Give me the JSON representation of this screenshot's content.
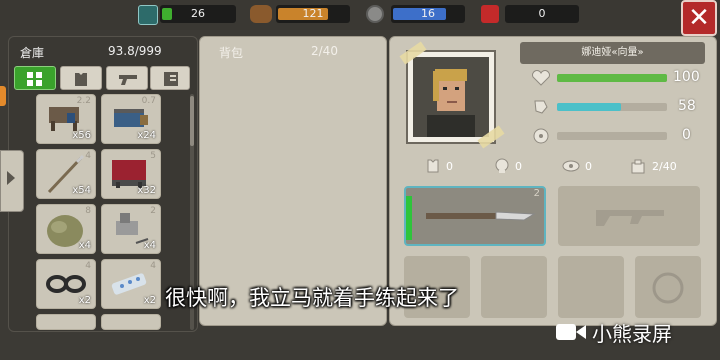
{
  "topbar": {
    "resources": [
      {
        "name": "energy",
        "value": "26",
        "fill": 0.14,
        "color": "#3fae2f"
      },
      {
        "name": "wood",
        "value": "121",
        "fill": 0.72,
        "color": "#c9832b"
      },
      {
        "name": "gear",
        "value": "16",
        "fill": 0.75,
        "color": "#3d6fc9"
      },
      {
        "name": "gift",
        "value": "0",
        "fill": 0,
        "color": "#3d6fc9"
      }
    ],
    "close_label": "✕"
  },
  "storage": {
    "title": "倉庫",
    "capacity": "93.8/999",
    "filters": [
      "all-icon",
      "armor-icon",
      "gun-icon",
      "list-icon"
    ],
    "items": [
      {
        "name": "workbench-item",
        "weight": "2.2",
        "count": "x56"
      },
      {
        "name": "toolbox-item",
        "weight": "0.7",
        "count": "x24"
      },
      {
        "name": "spear-item",
        "weight": "4",
        "count": "x54"
      },
      {
        "name": "red-crate-item",
        "weight": "5",
        "count": "x32"
      },
      {
        "name": "sack-item",
        "weight": "8",
        "count": "x4"
      },
      {
        "name": "parts-item",
        "weight": "2",
        "count": "x4"
      },
      {
        "name": "goggles-item",
        "weight": "4",
        "count": "x2"
      },
      {
        "name": "pills-item",
        "weight": "4",
        "count": "x2"
      }
    ]
  },
  "backpack": {
    "title": "背包",
    "capacity": "2/40"
  },
  "character": {
    "name": "娜迪娅«向量»",
    "stats": [
      {
        "name": "health",
        "value": "100",
        "fill": 1.0,
        "color": "#5fba45"
      },
      {
        "name": "hunger",
        "value": "58",
        "fill": 0.58,
        "color": "#4bc0c9"
      },
      {
        "name": "radiation",
        "value": "0",
        "fill": 0,
        "color": "#b3ad9f"
      }
    ],
    "mini": [
      {
        "name": "armor",
        "value": "0"
      },
      {
        "name": "skull",
        "value": "0"
      },
      {
        "name": "eye",
        "value": "0"
      },
      {
        "name": "weight",
        "value": "2/40"
      }
    ],
    "weapon_weight": "2"
  },
  "subtitle": "很快啊，我立马就着手练起来了",
  "watermark": "小熊录屏"
}
